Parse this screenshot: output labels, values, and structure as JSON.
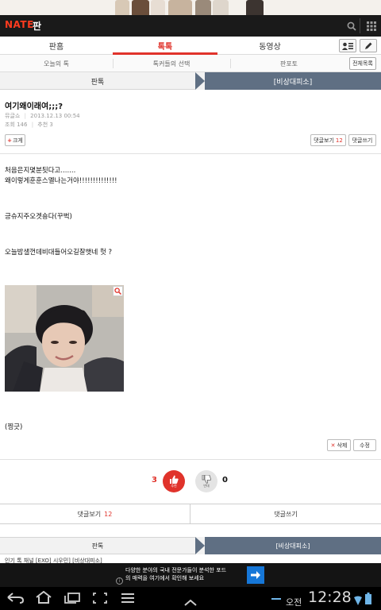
{
  "app": {
    "logo": "NATE",
    "logo_sub": "판"
  },
  "main_tabs": [
    {
      "label": "판홈"
    },
    {
      "label": "톡톡"
    },
    {
      "label": "동영상"
    }
  ],
  "sub_tabs": [
    {
      "label": "오늘의 톡"
    },
    {
      "label": "톡커들의 선택"
    },
    {
      "label": "판포토"
    }
  ],
  "all_list_label": "전체목록",
  "category": {
    "left": "판톡",
    "right": "[비상대피소]"
  },
  "post": {
    "title": "여기왜이래여;;;?",
    "author": "뮤글쇼",
    "date": "2013.12.13 00:54",
    "views": "조회 146",
    "recommends": "추천 3",
    "zoom_label": "크게",
    "comments_btn_label": "댓글보기",
    "comments_count": "12",
    "write_comment_label": "댓글쓰기",
    "body": [
      "처음은지몇분됫다고.......",
      "왜이렇게훈훈스멜나는거야!!!!!!!!!!!!!!",
      "긍슈지주오겟숑다(꾸벅)",
      "오늘밤샐껀데비대들어오길잘햇네 헛 ?",
      "(찡긋)"
    ],
    "delete_label": "삭제",
    "edit_label": "수정"
  },
  "vote": {
    "up_count": "3",
    "up_label": "추천",
    "down_count": "0",
    "down_label": "반대"
  },
  "bottom_tabs": {
    "comments_label": "댓글보기",
    "comments_count": "12",
    "write_label": "댓글쓰기"
  },
  "category2": {
    "left": "판톡",
    "right": "[비상대피소]"
  },
  "peek_text": "인기 톡 채널  [EXO] 시우민] [비상대피소]",
  "ad": {
    "line1": "다양한 분야의 국내 전문가들이 분석한 포드",
    "line2": "의 매력을 여기에서 확인해 보세요"
  },
  "system": {
    "ampm": "오전",
    "time": "12:28"
  },
  "colors": {
    "accent": "#e0332b",
    "category_dark": "#5f6f83",
    "logo": "#ff3b1f",
    "ad_button": "#1677d8"
  }
}
